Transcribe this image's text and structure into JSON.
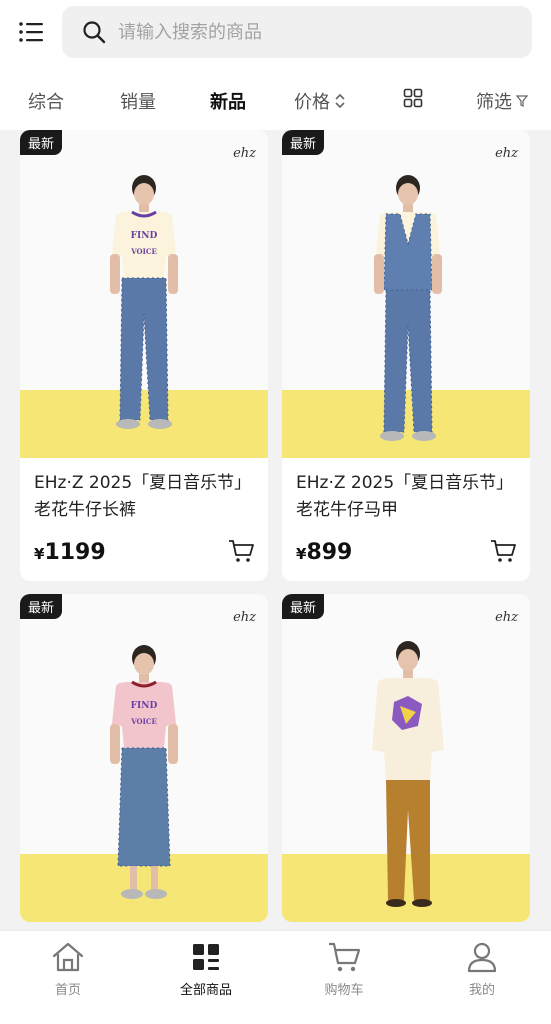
{
  "header": {
    "menu_icon": "menu-icon",
    "search_icon": "search-icon",
    "search_placeholder": "请输入搜索的商品"
  },
  "tabs": [
    {
      "label": "综合"
    },
    {
      "label": "销量"
    },
    {
      "label": "新品",
      "active": true
    },
    {
      "label": "价格",
      "icon": "sort-updown-icon"
    },
    {
      "label": "",
      "icon": "layout-grid-icon"
    },
    {
      "label": "筛选",
      "icon": "filter-icon"
    }
  ],
  "products": [
    {
      "badge": "最新",
      "brand": "ehz",
      "title": "EHz·Z 2025「夏日音乐节」老花牛仔长裤",
      "currency": "¥",
      "price": "1199"
    },
    {
      "badge": "最新",
      "brand": "ehz",
      "title": "EHz·Z 2025「夏日音乐节」老花牛仔马甲",
      "currency": "¥",
      "price": "899"
    },
    {
      "badge": "最新",
      "brand": "ehz"
    },
    {
      "badge": "最新",
      "brand": "ehz"
    }
  ],
  "bottom_nav": [
    {
      "label": "首页",
      "icon": "home-icon"
    },
    {
      "label": "全部商品",
      "icon": "all-products-icon",
      "active": true
    },
    {
      "label": "购物车",
      "icon": "cart-icon"
    },
    {
      "label": "我的",
      "icon": "profile-icon"
    }
  ],
  "colors": {
    "accent": "#111111",
    "floor_yellow": "#f6e675",
    "badge_bg": "#1a1a1a",
    "denim": "#5a79a8"
  }
}
